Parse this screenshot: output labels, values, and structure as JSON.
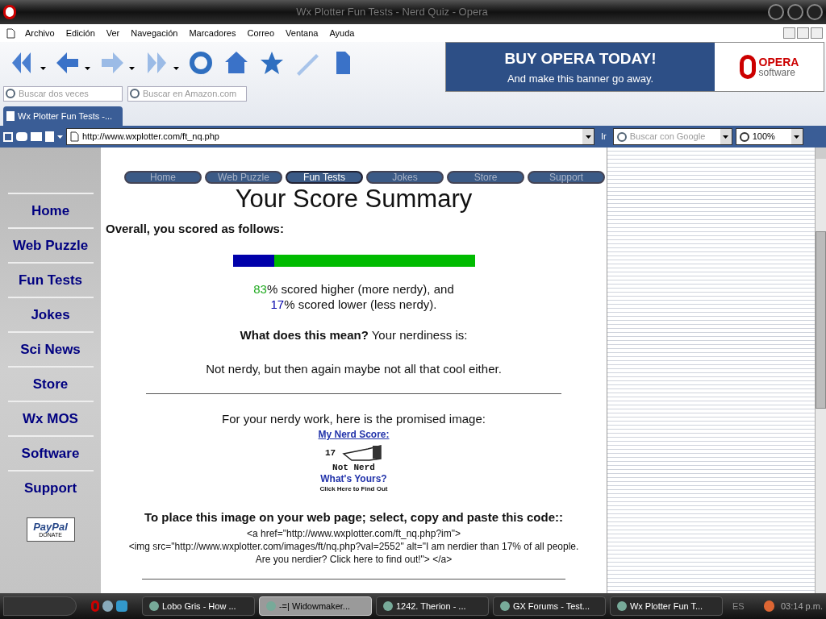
{
  "window": {
    "title": "Wx Plotter Fun Tests - Nerd Quiz - Opera"
  },
  "menu": [
    "Archivo",
    "Edición",
    "Ver",
    "Navegación",
    "Marcadores",
    "Correo",
    "Ventana",
    "Ayuda"
  ],
  "banner": {
    "headline": "BUY OPERA TODAY!",
    "subline": "And make this banner go away.",
    "logo_top": "OPERA",
    "logo_bottom": "software"
  },
  "search_fields": [
    {
      "placeholder": "Buscar dos veces"
    },
    {
      "placeholder": "Buscar en Amazon.com"
    }
  ],
  "tabs": [
    {
      "label": "Wx Plotter Fun Tests -...",
      "selected": true
    }
  ],
  "address_bar": {
    "url": "http://www.wxplotter.com/ft_nq.php",
    "go": "Ir",
    "search_placeholder": "Buscar con Google",
    "zoom": "100%"
  },
  "page": {
    "nav_tabs": [
      {
        "label": "Home",
        "selected": false
      },
      {
        "label": "Web Puzzle",
        "selected": false
      },
      {
        "label": "Fun Tests",
        "selected": true
      },
      {
        "label": "Jokes",
        "selected": false
      },
      {
        "label": "Store",
        "selected": false
      },
      {
        "label": "Support",
        "selected": false
      }
    ],
    "sidebar": [
      "Home",
      "Web Puzzle",
      "Fun Tests",
      "Jokes",
      "Sci News",
      "Store",
      "Wx MOS",
      "Software",
      "Support"
    ],
    "paypal": {
      "logo": "PayPal",
      "label": "DONATE"
    },
    "heading": "Your Score Summary",
    "intro": "Overall, you scored as follows:",
    "score_bar": {
      "level": 0.17
    },
    "stats": [
      {
        "value": "83",
        "text": "% scored higher (more nerdy), and",
        "color": "#22aa22"
      },
      {
        "value": "17",
        "text": "% scored lower (less nerdy).",
        "color": "#0000aa"
      }
    ],
    "meaning": "**What does this mean?** Your nerdiness is:",
    "verdict": "Not nerdy, but then again maybe not all that cool either.",
    "image_intro": "For your nerdy work, here is the promised image:",
    "badge": {
      "title": "My Nerd Score:",
      "score": "17",
      "rank": "Not Nerd",
      "question": "What's Yours?",
      "cta": "Click Here to Find Out"
    },
    "code_heading": "To place this image on your web page; select, copy and paste this code::",
    "code_lines": [
      "<a href=\"http://www.wxplotter.com/ft_nq.php?im\">",
      "<img src=\"http://www.wxplotter.com/images/ft/nq.php?val=2552\" alt=\"I am nerdier than 17% of all people.",
      "Are you nerdier? Click here to find out!\"> </a>"
    ]
  },
  "taskbar": [
    {
      "label": "Lobo Gris - How ...",
      "selected": false
    },
    {
      "label": "-=| Widowmaker...",
      "selected": true
    },
    {
      "label": "1242. Therion - ...",
      "selected": false
    },
    {
      "label": "GX Forums - Test...",
      "selected": false
    },
    {
      "label": "Wx Plotter Fun T...",
      "selected": false
    }
  ],
  "tray": {
    "language": "ES",
    "clock": "03:14 p.m."
  }
}
